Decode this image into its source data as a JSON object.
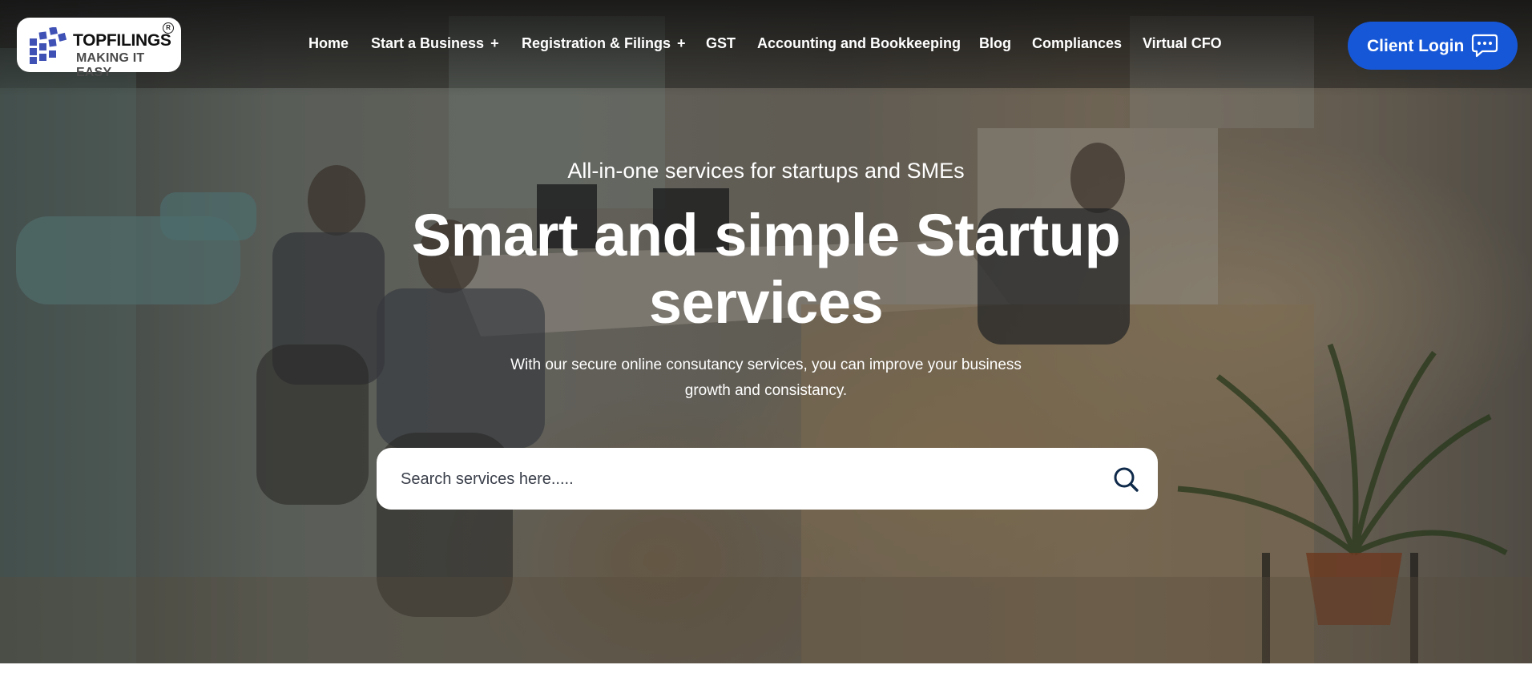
{
  "header": {
    "logo": {
      "name": "TOPFILINGS",
      "tagline": "MAKING IT EASY",
      "registered_mark": "R",
      "brand_color": "#3f51b5"
    },
    "nav": [
      {
        "label": "Home",
        "has_submenu": false
      },
      {
        "label": "Start a Business",
        "has_submenu": true
      },
      {
        "label": "Registration & Filings",
        "has_submenu": true
      },
      {
        "label": "GST",
        "has_submenu": false
      },
      {
        "label": "Accounting and Bookkeeping",
        "has_submenu": false
      },
      {
        "label": "Blog",
        "has_submenu": false
      },
      {
        "label": "Compliances",
        "has_submenu": false
      },
      {
        "label": "Virtual CFO",
        "has_submenu": false
      }
    ],
    "submenu_indicator": "+",
    "client_login": {
      "label": "Client Login",
      "icon": "chat-bubble-icon",
      "color": "#1657d8"
    }
  },
  "hero": {
    "kicker": "All-in-one services for startups and SMEs",
    "headline_line1": "Smart and simple Startup",
    "headline_line2": "services",
    "subtext_line1": "With our secure online consutancy services, you can improve your business",
    "subtext_line2": "growth and consistancy.",
    "search": {
      "placeholder": "Search services here.....",
      "value": "",
      "icon": "search-icon"
    }
  }
}
